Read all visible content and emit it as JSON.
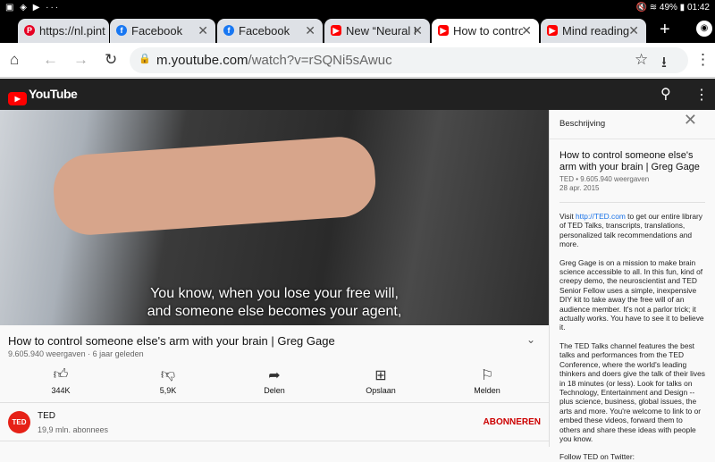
{
  "status": {
    "left": "▣ ◈ ▶ ···",
    "right": "🔇 ≋ 49% ▮ 01:42"
  },
  "tabs": [
    {
      "title": "https://nl.pint",
      "favicon": "P",
      "color": "#e60023"
    },
    {
      "title": "Facebook",
      "favicon": "f",
      "color": "#1877f2"
    },
    {
      "title": "Facebook",
      "favicon": "f",
      "color": "#1877f2"
    },
    {
      "title": "New “Neural D",
      "favicon": "▶",
      "color": "#ff0000"
    },
    {
      "title": "How to contro",
      "favicon": "▶",
      "color": "#ff0000",
      "active": true
    },
    {
      "title": "Mind reading",
      "favicon": "▶",
      "color": "#ff0000"
    }
  ],
  "address": {
    "host": "m.youtube.com",
    "path": "/watch?v=rSQNi5sAwuc"
  },
  "youtube": {
    "logo": "YouTube"
  },
  "video": {
    "subtitle1": "You know, when you lose your free will,",
    "subtitle2": "and someone else becomes your agent,"
  },
  "info": {
    "title": "How to control someone else's arm with your brain | Greg Gage",
    "meta": "9.605.940 weergaven · 6 jaar geleden",
    "actions": [
      {
        "label": "344K",
        "icon": "thumb-up"
      },
      {
        "label": "5,9K",
        "icon": "thumb-down"
      },
      {
        "label": "Delen",
        "icon": "share"
      },
      {
        "label": "Opslaan",
        "icon": "save"
      },
      {
        "label": "Melden",
        "icon": "flag"
      }
    ],
    "channel": {
      "name": "TED",
      "avatar": "TED",
      "subs": "19,9 mln. abonnees",
      "subscribe": "ABONNEREN"
    }
  },
  "panel": {
    "header": "Beschrijving",
    "title": "How to control someone else's arm with your brain | Greg Gage",
    "meta1": "TED • 9.605.940 weergaven",
    "meta2": "28 apr. 2015",
    "p1_pre": "Visit ",
    "p1_link": "http://TED.com",
    "p1_post": " to get our entire library of TED Talks, transcripts, translations, personalized talk recommendations and more.",
    "p2": "Greg Gage is on a mission to make brain science accessible to all. In this fun, kind of creepy demo, the neuroscientist and TED Senior Fellow uses a simple, inexpensive DIY kit to take away the free will of an audience member. It's not a parlor trick; it actually works. You have to see it to believe it.",
    "p3": "The TED Talks channel features the best talks and performances from the TED Conference, where the world's leading thinkers and doers give the talk of their lives in 18 minutes (or less). Look for talks on Technology, Entertainment and Design -- plus science, business, global issues, the arts and more. You're welcome to link to or embed these videos, forward them to others and share these ideas with people you know.",
    "p4": "Follow TED on Twitter:"
  }
}
